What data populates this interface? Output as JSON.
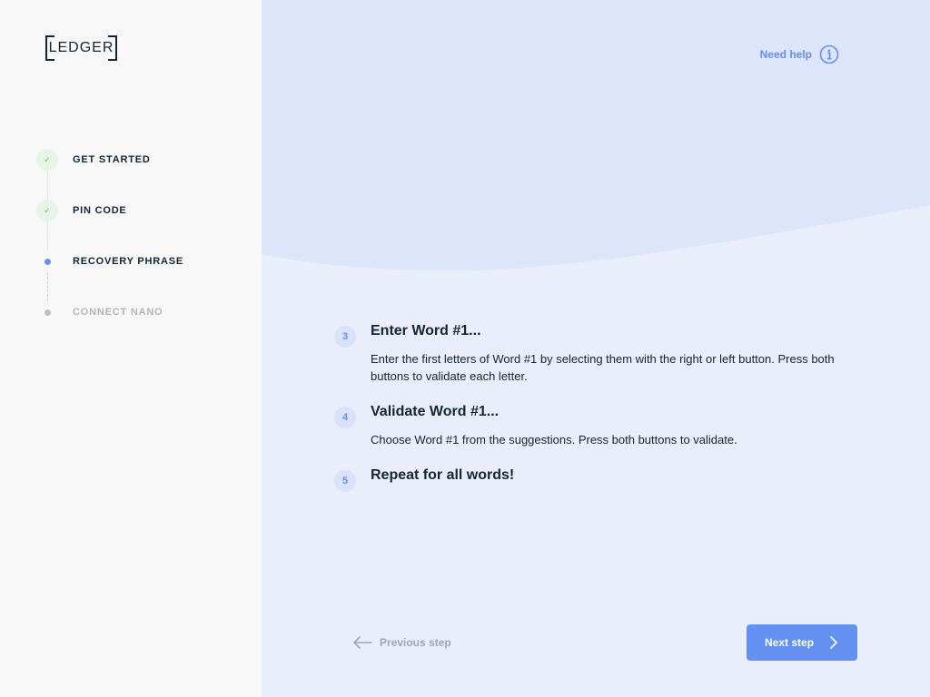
{
  "brand": {
    "logo_text": "LEDGER",
    "accent": "#6490f1",
    "success": "#66be54"
  },
  "sidebar": {
    "steps": [
      {
        "label": "GET STARTED",
        "status": "done",
        "icon": "check-icon"
      },
      {
        "label": "PIN CODE",
        "status": "done",
        "icon": "check-icon"
      },
      {
        "label": "RECOVERY PHRASE",
        "status": "active"
      },
      {
        "label": "CONNECT NANO",
        "status": "pending"
      }
    ]
  },
  "header": {
    "help_label": "Need help",
    "help_icon": "info-circle-icon"
  },
  "instructions": [
    {
      "number": "3",
      "title": "Enter Word #1...",
      "description": "Enter the first letters of Word #1 by selecting them with the right or left button. Press both buttons to validate each letter."
    },
    {
      "number": "4",
      "title": "Validate Word #1...",
      "description": "Choose Word #1 from the suggestions. Press both buttons to validate."
    },
    {
      "number": "5",
      "title": "Repeat for all words!",
      "description": ""
    }
  ],
  "footer": {
    "previous_label": "Previous step",
    "next_label": "Next step",
    "previous_icon": "arrow-left-icon",
    "next_icon": "chevron-right-icon"
  }
}
